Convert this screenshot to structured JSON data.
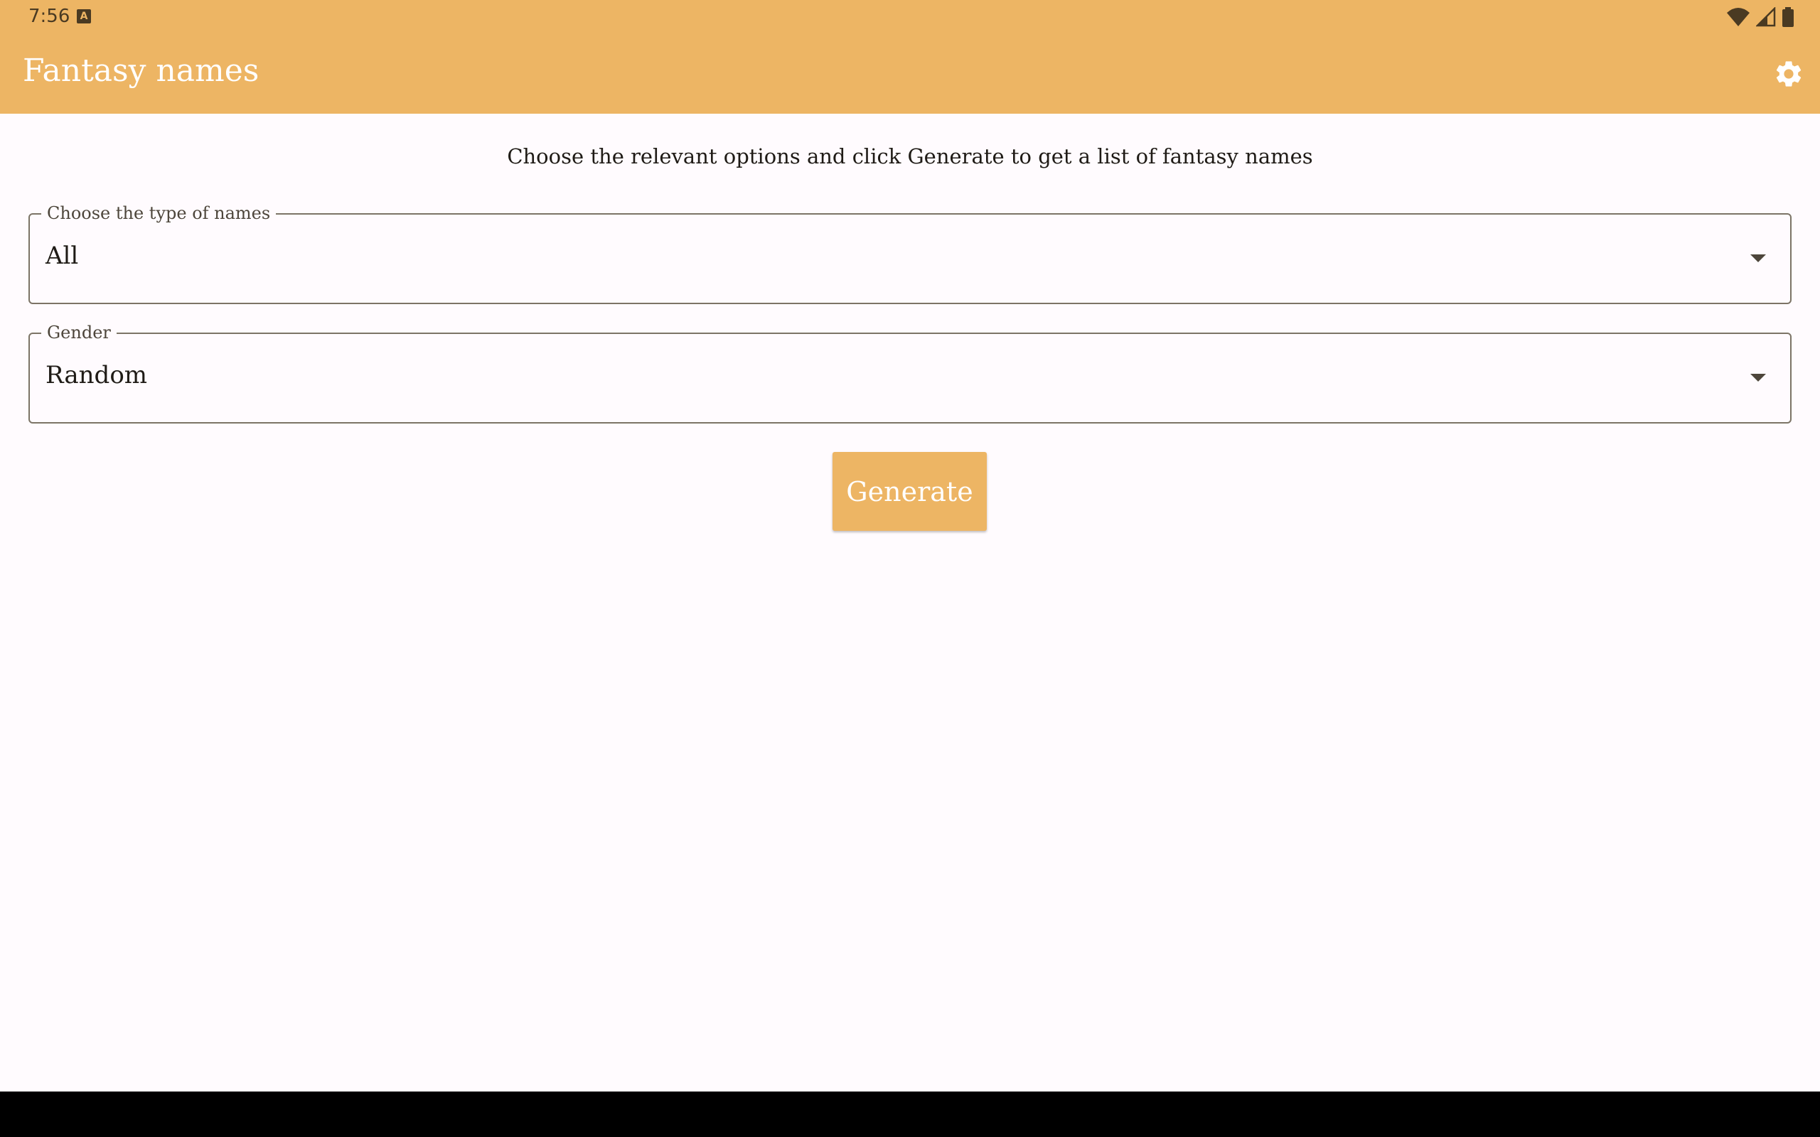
{
  "status_bar": {
    "time": "7:56",
    "notification_glyph": "A",
    "icons": [
      "wifi-icon",
      "signal-icon",
      "battery-icon"
    ]
  },
  "app_bar": {
    "title": "Fantasy names",
    "settings_icon": "gear-icon"
  },
  "main": {
    "intro": "Choose the relevant options and click Generate to get a list of fantasy names",
    "type_field": {
      "label": "Choose the type of names",
      "value": "All"
    },
    "gender_field": {
      "label": "Gender",
      "value": "Random"
    },
    "generate_label": "Generate"
  },
  "colors": {
    "primary": "#edb564",
    "on_primary": "#ffffff",
    "background": "#fffbfe",
    "outline": "#7c7466"
  }
}
